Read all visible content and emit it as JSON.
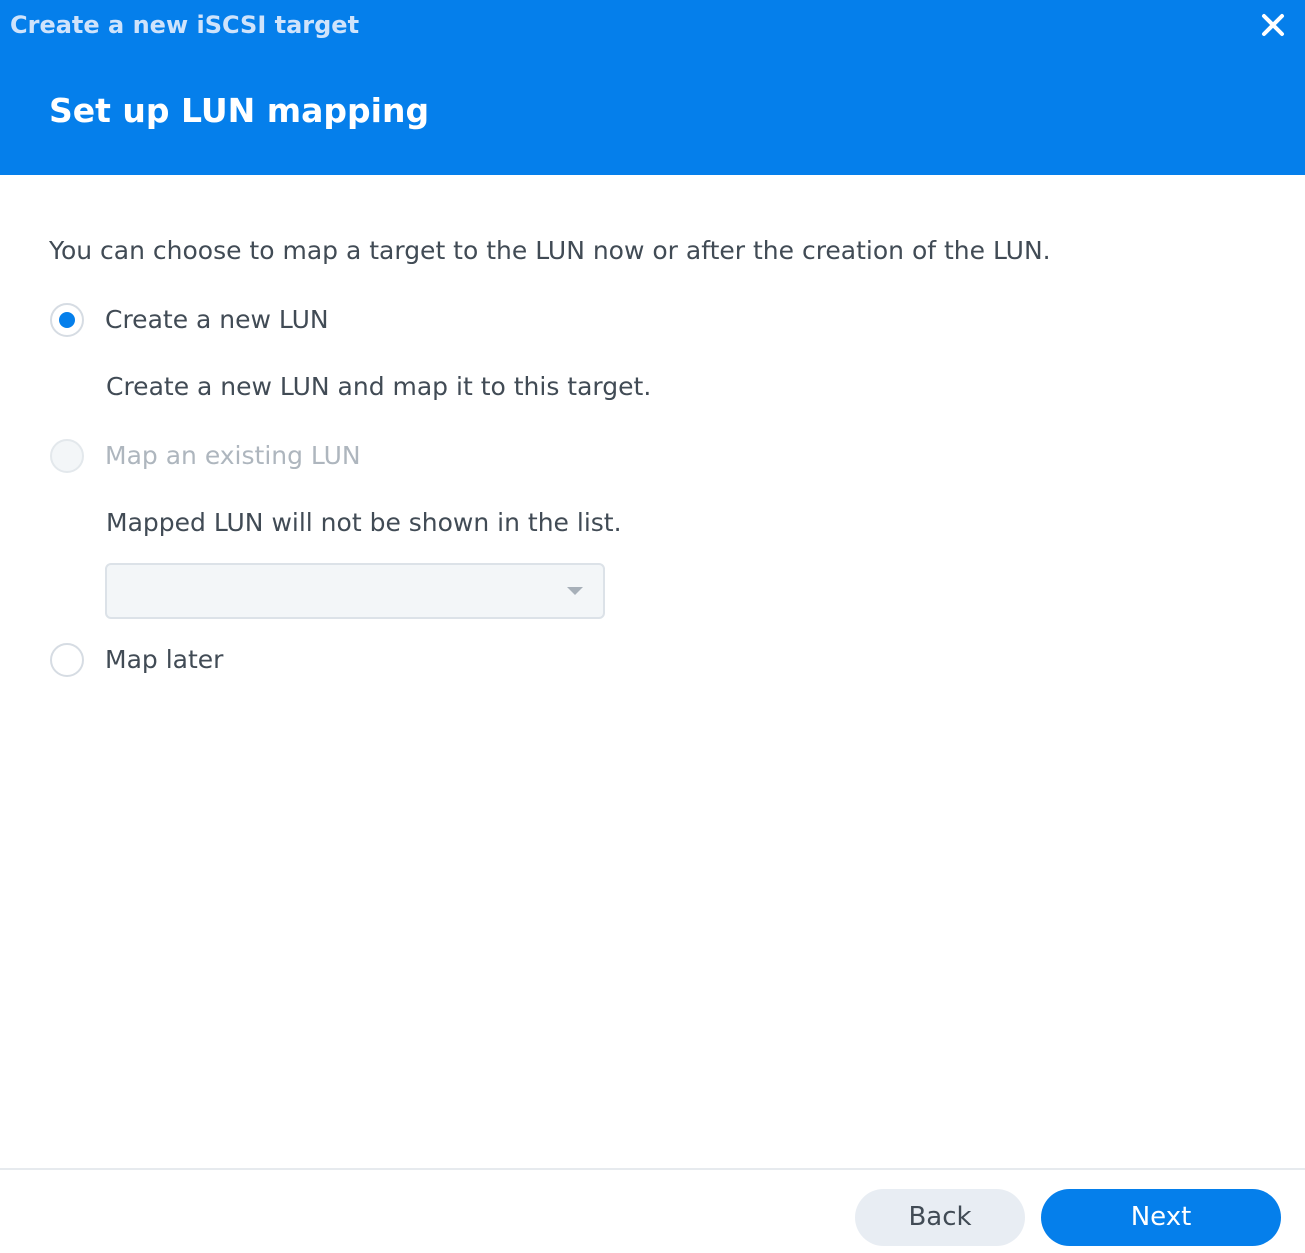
{
  "window": {
    "title": "Create a new iSCSI target"
  },
  "step": {
    "title": "Set up LUN mapping",
    "description": "You can choose to map a target to the LUN now or after the creation of the LUN."
  },
  "options": [
    {
      "label": "Create a new LUN",
      "checked": true,
      "disabled": false,
      "hint": "Create a new LUN and map it to this target."
    },
    {
      "label": "Map an existing LUN",
      "checked": false,
      "disabled": true,
      "hint": "Mapped LUN will not be shown in the list."
    },
    {
      "label": "Map later",
      "checked": false,
      "disabled": false
    }
  ],
  "lun_select": {
    "value": "",
    "disabled": true
  },
  "footer": {
    "back_label": "Back",
    "next_label": "Next"
  },
  "colors": {
    "accent": "#057feb",
    "text": "#414b55",
    "disabled_text": "#aeb6be"
  },
  "icons": {
    "close": "close-icon",
    "dropdown": "chevron-down-icon"
  }
}
